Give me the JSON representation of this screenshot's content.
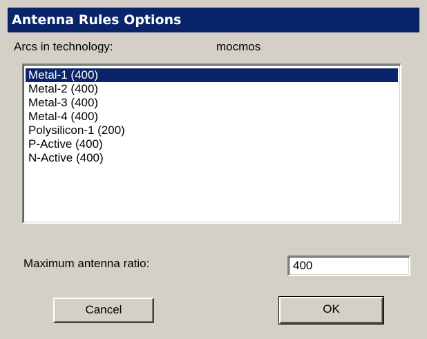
{
  "dialog": {
    "title": "Antenna Rules Options",
    "arcs_label": "Arcs in technology:",
    "technology": "mocmos",
    "arcs": [
      {
        "label": "Metal-1 (400)",
        "selected": true
      },
      {
        "label": "Metal-2 (400)",
        "selected": false
      },
      {
        "label": "Metal-3 (400)",
        "selected": false
      },
      {
        "label": "Metal-4 (400)",
        "selected": false
      },
      {
        "label": "Polysilicon-1 (200)",
        "selected": false
      },
      {
        "label": "P-Active (400)",
        "selected": false
      },
      {
        "label": "N-Active (400)",
        "selected": false
      }
    ],
    "max_ratio_label": "Maximum antenna ratio:",
    "max_ratio_value": "400",
    "cancel_label": "Cancel",
    "ok_label": "OK"
  },
  "colors": {
    "dialog_bg": "#d4d0c8",
    "title_bg": "#0a246a",
    "selection_bg": "#0a246a",
    "selection_text": "#ffffff"
  }
}
